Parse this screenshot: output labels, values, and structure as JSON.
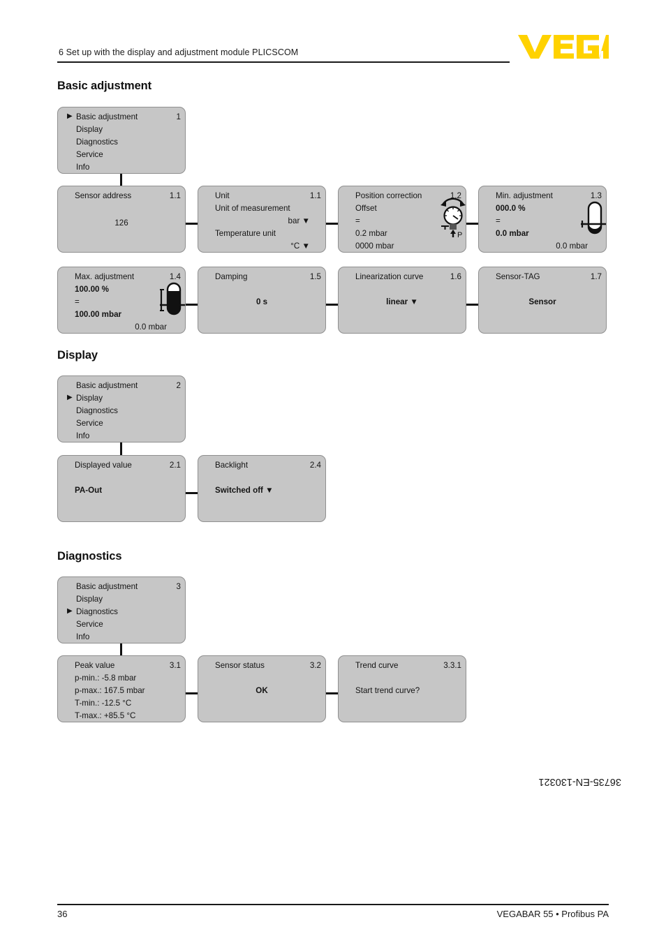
{
  "header": {
    "chapter": "6 Set up with the display and adjustment module PLICSCOM",
    "logo_alt": "VEGA",
    "logo_color": "#FFD200"
  },
  "footer": {
    "page_number": "36",
    "document_title": "VEGABAR 55 • Profibus PA",
    "document_code": "36735-EN-130321"
  },
  "sections": [
    {
      "title": "Basic adjustment",
      "menu": {
        "number": "1",
        "selected_index": 0,
        "items": [
          "Basic adjustment",
          "Display",
          "Diagnostics",
          "Service",
          "Info"
        ]
      },
      "boxes": [
        {
          "number": "1.1",
          "title": "Sensor address",
          "lines": [
            {
              "text": "126",
              "bold": false,
              "align": "center"
            }
          ]
        },
        {
          "number": "1.1",
          "title": "Unit",
          "lines": [
            {
              "text": "Unit of measurement",
              "bold": false,
              "align": "left"
            },
            {
              "text": "bar ▼",
              "bold": false,
              "align": "right"
            },
            {
              "text": "Temperature unit",
              "bold": false,
              "align": "left"
            },
            {
              "text": "°C ▼",
              "bold": false,
              "align": "right"
            }
          ]
        },
        {
          "number": "1.2",
          "title": "Position correction",
          "icon": "pressure-gauge-icon",
          "lines": [
            {
              "text": "Offset",
              "bold": false,
              "align": "left"
            },
            {
              "text": "=",
              "bold": false,
              "align": "left"
            },
            {
              "text": "0.2 mbar",
              "bold": false,
              "align": "left"
            },
            {
              "text": "0000 mbar",
              "bold": false,
              "align": "left"
            }
          ]
        },
        {
          "number": "1.3",
          "title": "Min. adjustment",
          "icon": "tank-low-level-icon",
          "lines": [
            {
              "text": "000.0 %",
              "bold": true,
              "align": "left"
            },
            {
              "text": "=",
              "bold": false,
              "align": "left"
            },
            {
              "text": "0.0 mbar",
              "bold": true,
              "align": "left"
            },
            {
              "text": "0.0 mbar",
              "bold": false,
              "align": "right"
            }
          ]
        },
        {
          "number": "1.4",
          "title": "Max. adjustment",
          "icon": "tank-high-level-icon",
          "lines": [
            {
              "text": "100.00 %",
              "bold": true,
              "align": "left"
            },
            {
              "text": "=",
              "bold": false,
              "align": "left"
            },
            {
              "text": "100.00 mbar",
              "bold": true,
              "align": "left"
            },
            {
              "text": "0.0 mbar",
              "bold": false,
              "align": "right"
            }
          ]
        },
        {
          "number": "1.5",
          "title": "Damping",
          "lines": [
            {
              "text": "0 s",
              "bold": true,
              "align": "center"
            }
          ]
        },
        {
          "number": "1.6",
          "title": "Linearization curve",
          "lines": [
            {
              "text": "linear ▼",
              "bold": true,
              "align": "center"
            }
          ]
        },
        {
          "number": "1.7",
          "title": "Sensor-TAG",
          "lines": [
            {
              "text": "Sensor",
              "bold": true,
              "align": "center"
            }
          ]
        }
      ]
    },
    {
      "title": "Display",
      "menu": {
        "number": "2",
        "selected_index": 1,
        "items": [
          "Basic adjustment",
          "Display",
          "Diagnostics",
          "Service",
          "Info"
        ]
      },
      "boxes": [
        {
          "number": "2.1",
          "title": "Displayed value",
          "lines": [
            {
              "text": "PA-Out",
              "bold": true,
              "align": "left"
            }
          ]
        },
        {
          "number": "2.4",
          "title": "Backlight",
          "lines": [
            {
              "text": "Switched off ▼",
              "bold": true,
              "align": "left"
            }
          ]
        }
      ]
    },
    {
      "title": "Diagnostics",
      "menu": {
        "number": "3",
        "selected_index": 2,
        "items": [
          "Basic adjustment",
          "Display",
          "Diagnostics",
          "Service",
          "Info"
        ]
      },
      "boxes": [
        {
          "number": "3.1",
          "title": "Peak value",
          "lines": [
            {
              "text": "p-min.: -5.8 mbar",
              "bold": false,
              "align": "left"
            },
            {
              "text": "p-max.: 167.5 mbar",
              "bold": false,
              "align": "left"
            },
            {
              "text": "T-min.: -12.5 °C",
              "bold": false,
              "align": "left"
            },
            {
              "text": "T-max.: +85.5 °C",
              "bold": false,
              "align": "left"
            }
          ]
        },
        {
          "number": "3.2",
          "title": "Sensor status",
          "lines": [
            {
              "text": "OK",
              "bold": true,
              "align": "center"
            }
          ]
        },
        {
          "number": "3.3.1",
          "title": "Trend curve",
          "lines": [
            {
              "text": "Start trend curve?",
              "bold": false,
              "align": "left"
            }
          ]
        }
      ]
    }
  ]
}
